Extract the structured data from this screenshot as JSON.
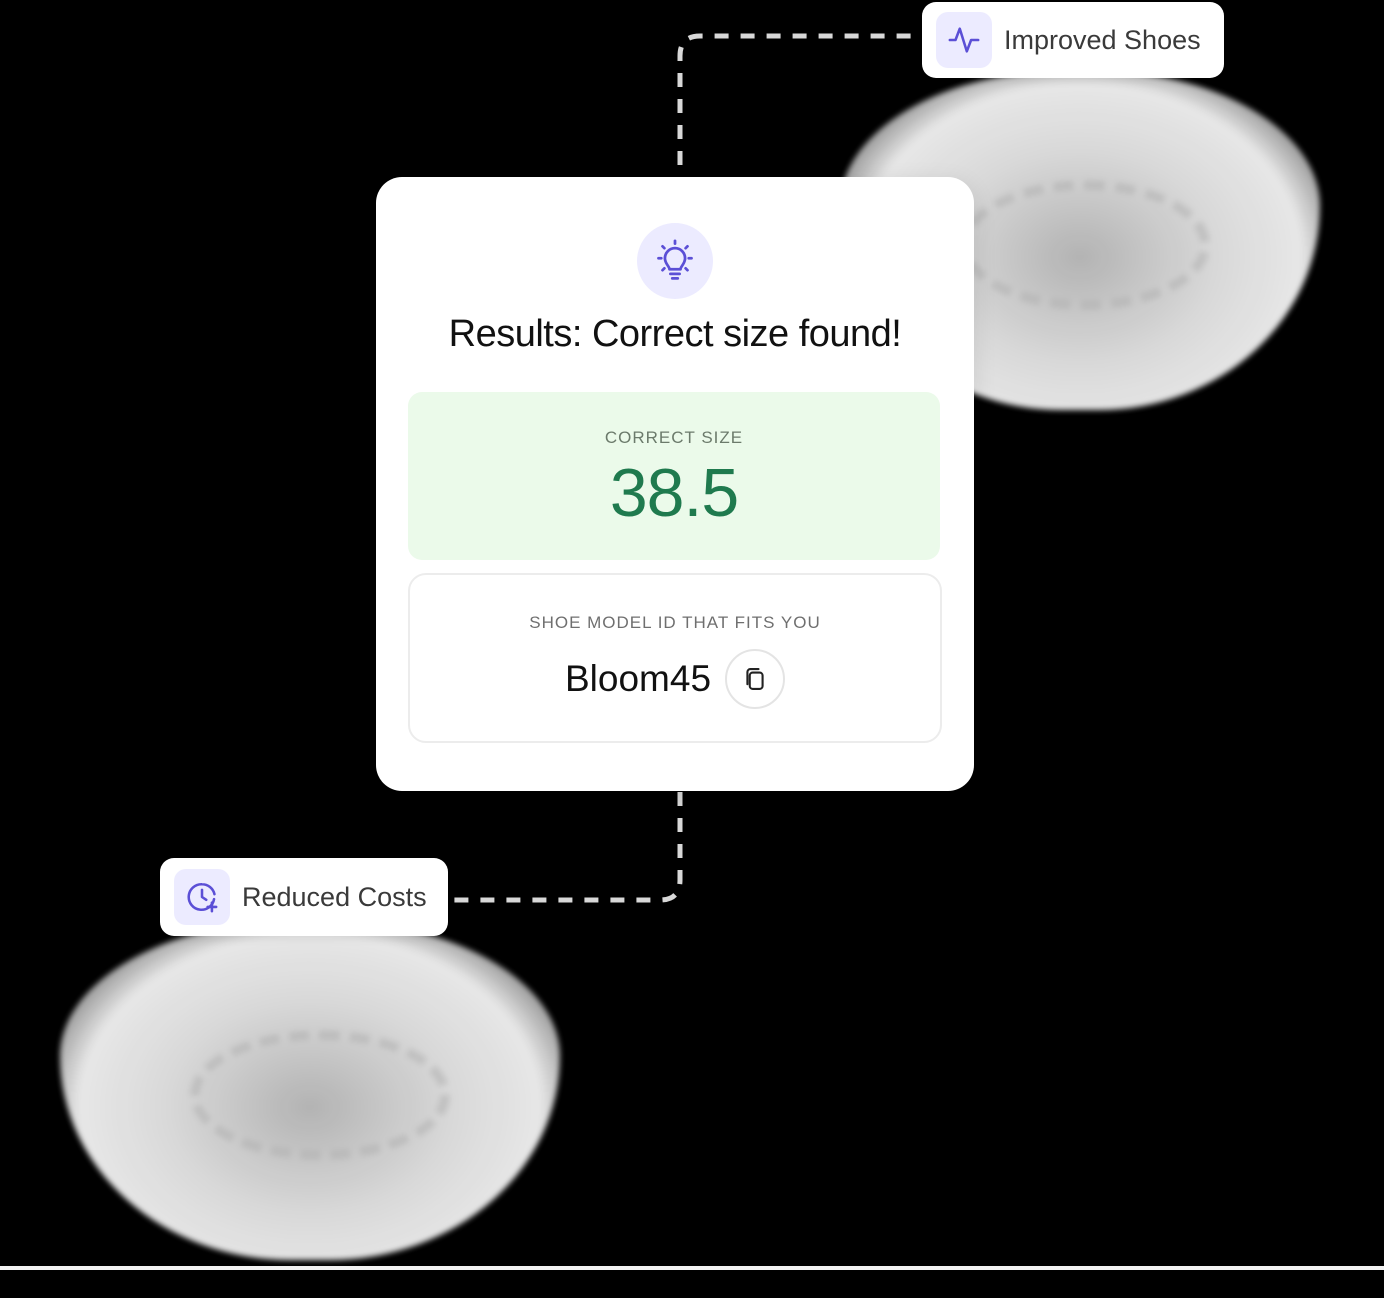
{
  "card": {
    "title": "Results: Correct size found!",
    "icon": "lightbulb-icon",
    "correct_size": {
      "label": "CORRECT SIZE",
      "value": "38.5"
    },
    "model": {
      "label": "SHOE MODEL ID THAT FITS YOU",
      "value": "Bloom45",
      "copy_icon": "copy-icon"
    }
  },
  "tags": {
    "top": {
      "label": "Improved Shoes",
      "icon": "activity-pulse-icon"
    },
    "bottom": {
      "label": "Reduced Costs",
      "icon": "clock-plus-icon"
    }
  },
  "colors": {
    "accent": "#5b4fd6",
    "accent_bg": "#ecebff",
    "success_bg": "#ebfaea",
    "success_text": "#1f7a4e"
  }
}
